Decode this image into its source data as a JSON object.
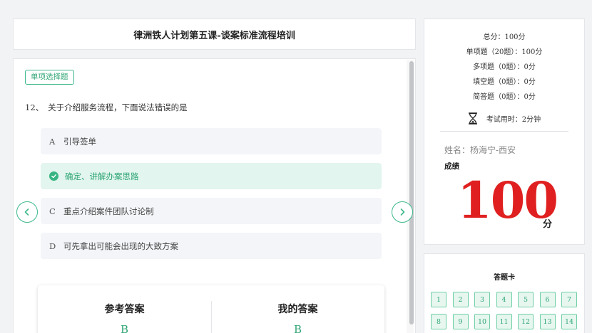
{
  "header": {
    "title": "律洲铁人计划第五课-谈案标准流程培训"
  },
  "question": {
    "type_tag": "单项选择题",
    "number": "12、",
    "text": "关于介绍服务流程，下面说法错误的是",
    "options": [
      {
        "letter": "A",
        "text": "引导签单",
        "state": "normal"
      },
      {
        "letter": "",
        "text": "确定、讲解办案思路",
        "state": "correct"
      },
      {
        "letter": "C",
        "text": "重点介绍案件团队讨论制",
        "state": "normal"
      },
      {
        "letter": "D",
        "text": "可先拿出可能会出现的大致方案",
        "state": "normal"
      }
    ]
  },
  "answers": {
    "reference_label": "参考答案",
    "reference_value": "B",
    "mine_label": "我的答案",
    "mine_value": "B"
  },
  "summary": {
    "total": "总分：100分",
    "single": "单项题（20题）：100分",
    "multi": "多项题（0题）：0分",
    "fill": "填空题（0题）：0分",
    "short": "简答题（0题）：0分",
    "time": "考试用时：2分钟",
    "name": "姓名：杨海宁-西安",
    "grade_label": "成绩",
    "score": "100",
    "score_unit": "分"
  },
  "answer_sheet": {
    "title": "答题卡",
    "items": [
      "1",
      "2",
      "3",
      "4",
      "5",
      "6",
      "7",
      "8",
      "9",
      "10",
      "11",
      "12",
      "13",
      "14"
    ]
  },
  "colors": {
    "accent": "#3cb88a",
    "score": "#e02020"
  }
}
